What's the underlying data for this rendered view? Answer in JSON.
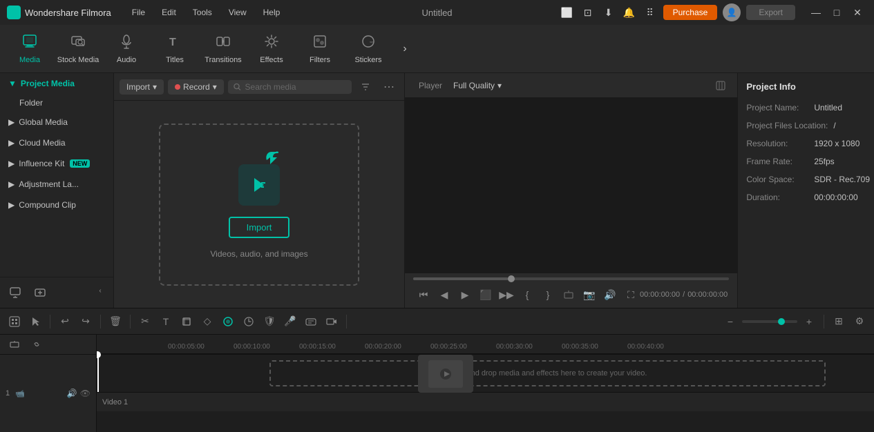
{
  "app": {
    "name": "Wondershare Filmora",
    "title": "Untitled",
    "logo_char": "F"
  },
  "titlebar": {
    "menus": [
      "File",
      "Edit",
      "Tools",
      "View",
      "Help"
    ],
    "purchase_label": "Purchase",
    "export_label": "Export",
    "minimize": "—",
    "maximize": "□",
    "close": "✕"
  },
  "toolbar": {
    "items": [
      {
        "id": "media",
        "label": "Media",
        "icon": "▣",
        "active": true
      },
      {
        "id": "stock",
        "label": "Stock Media",
        "icon": "🎬"
      },
      {
        "id": "audio",
        "label": "Audio",
        "icon": "♫"
      },
      {
        "id": "titles",
        "label": "Titles",
        "icon": "T"
      },
      {
        "id": "transitions",
        "label": "Transitions",
        "icon": "⧗"
      },
      {
        "id": "effects",
        "label": "Effects",
        "icon": "✦"
      },
      {
        "id": "filters",
        "label": "Filters",
        "icon": "◈"
      },
      {
        "id": "stickers",
        "label": "Stickers",
        "icon": "◉"
      }
    ],
    "more_icon": "›"
  },
  "sidebar": {
    "project_media_label": "Project Media",
    "folder_label": "Folder",
    "sections": [
      {
        "id": "global",
        "label": "Global Media",
        "badge": null
      },
      {
        "id": "cloud",
        "label": "Cloud Media",
        "badge": null
      },
      {
        "id": "influence",
        "label": "Influence Kit",
        "badge": "NEW"
      },
      {
        "id": "adjustment",
        "label": "Adjustment La...",
        "badge": null
      },
      {
        "id": "compound",
        "label": "Compound Clip",
        "badge": null
      }
    ],
    "add_icon": "+",
    "link_icon": "🔗",
    "collapse_icon": "‹"
  },
  "media_panel": {
    "import_label": "Import",
    "record_label": "Record",
    "search_placeholder": "Search media",
    "filter_icon": "≡",
    "more_icon": "⋯",
    "import_area": {
      "button_label": "Import",
      "hint_text": "Videos, audio, and images"
    }
  },
  "player": {
    "tab_label": "Player",
    "quality_label": "Full Quality",
    "time_current": "00:00:00:00",
    "time_separator": "/",
    "time_total": "00:00:00:00"
  },
  "project_info": {
    "title": "Project Info",
    "fields": [
      {
        "label": "Project Name:",
        "value": "Untitled"
      },
      {
        "label": "Project Files Location:",
        "value": "/"
      },
      {
        "label": "Resolution:",
        "value": "1920 x 1080"
      },
      {
        "label": "Frame Rate:",
        "value": "25fps"
      },
      {
        "label": "Color Space:",
        "value": "SDR - Rec.709"
      },
      {
        "label": "Duration:",
        "value": "00:00:00:00"
      }
    ]
  },
  "timeline": {
    "ruler_marks": [
      "00:00:05:00",
      "00:00:10:00",
      "00:00:15:00",
      "00:00:20:00",
      "00:00:25:00",
      "00:00:30:00",
      "00:00:35:00",
      "00:00:40:00"
    ],
    "track_label": "Video 1",
    "add_icon": "+",
    "drop_hint": "Drag and drop media and effects here to create your video.",
    "video_icon": "📹",
    "track_num": "1"
  }
}
